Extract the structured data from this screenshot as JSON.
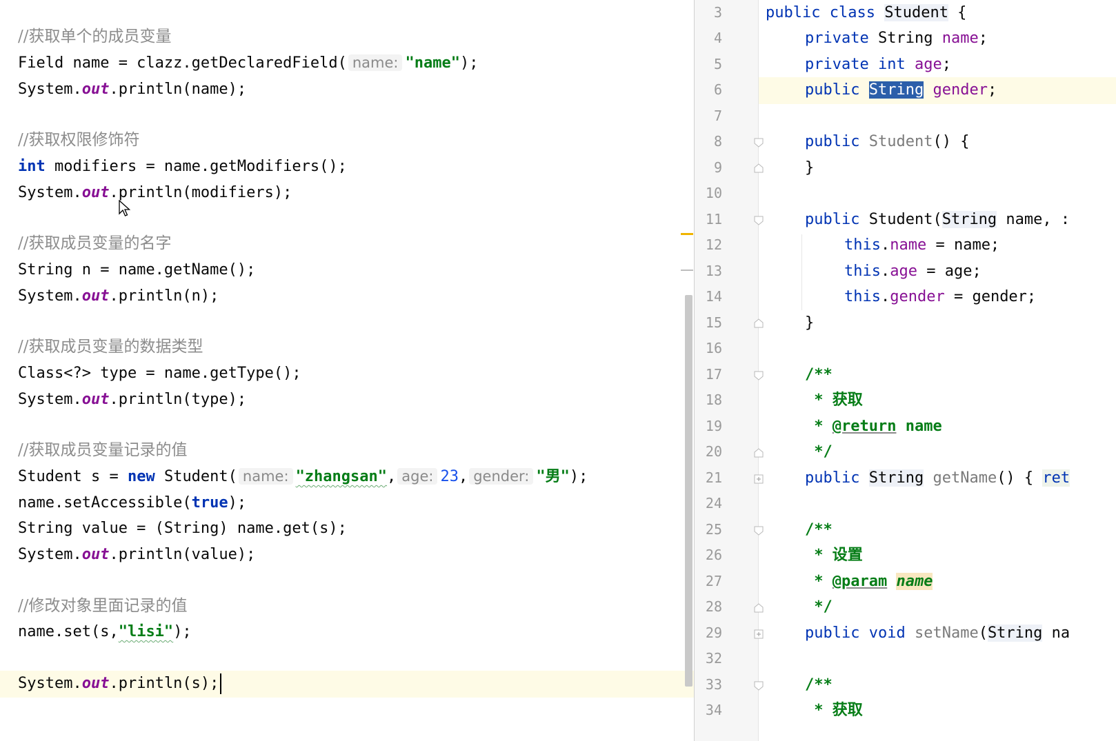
{
  "left_editor": {
    "comment1": "//获取单个的成员变量",
    "l1_p1": "Field name = clazz.getDeclaredField(",
    "l1_hint": "name:",
    "l1_str": "\"name\"",
    "l1_end": ");",
    "l2_p1": "System.",
    "out": "out",
    "l2_p2": ".println(name);",
    "comment2": "//获取权限修饰符",
    "l3_kw": "int",
    "l3_rest": " modifiers = name.getModifiers();",
    "l4_p2": ".println(modifiers);",
    "comment3": "//获取成员变量的名字",
    "l5": "String n = name.getName();",
    "l6_p2": ".println(n);",
    "comment4": "//获取成员变量的数据类型",
    "l7": "Class<?> type = name.getType();",
    "l8_p2": ".println(type);",
    "comment5": "//获取成员变量记录的值",
    "l9_p1": "Student s = ",
    "l9_kw": "new",
    "l9_p2": " Student(",
    "l9_hint1": "name:",
    "l9_str1": "\"zhangsan\"",
    "l9_hint2": "age:",
    "l9_num": "23",
    "l9_hint3": "gender:",
    "l9_str2": "\"男\"",
    "l9_end": ");",
    "l10_p1": "name.setAccessible(",
    "l10_kw": "true",
    "l10_end": ");",
    "l11": "String value = (String) name.get(s);",
    "l12_p2": ".println(value);",
    "comment6": "//修改对象里面记录的值",
    "l13_p1": "name.set(s,",
    "l13_str": "\"lisi\"",
    "l13_end": ");",
    "l14_p2": ".println(s);",
    "comma": ",",
    "sep": ", "
  },
  "right_editor": {
    "line_numbers": [
      "3",
      "4",
      "5",
      "6",
      "7",
      "8",
      "9",
      "10",
      "11",
      "12",
      "13",
      "14",
      "15",
      "16",
      "17",
      "18",
      "19",
      "20",
      "21",
      "24",
      "25",
      "26",
      "27",
      "28",
      "29",
      "32",
      "33",
      "34"
    ],
    "public": "public",
    "private": "private",
    "class": "class",
    "void": "void",
    "int": "int",
    "this": "this",
    "String": "String",
    "Student": "Student",
    "name_field": "name",
    "age_field": "age",
    "gender_field": "gender",
    "open_brace": " {",
    "close_brace": "}",
    "semicolon": ";",
    "ctor_empty": "()",
    "ctor_params_p1": "(",
    "ctor_params_p2": " name, :",
    "assign_name": " = name;",
    "assign_age": " = age;",
    "assign_gender": " = gender;",
    "dot": ".",
    "jd_open": "/**",
    "jd_star": " *",
    "jd_close": " */",
    "jd_get": "获取",
    "jd_set": "设置",
    "jd_return": "@return",
    "jd_param": "@param",
    "jd_name": "name",
    "getName": "getName",
    "getName_rest": "() { ",
    "ret_trunc": "ret",
    "setName": "setName",
    "setName_p1": "(",
    "setName_trunc": " na"
  },
  "colors": {
    "keyword": "#0033b3",
    "string": "#067d17",
    "field": "#871094",
    "comment": "#8c8c8c",
    "number": "#1750eb",
    "current_line": "#fefbe6",
    "selection": "#2b5faa"
  }
}
